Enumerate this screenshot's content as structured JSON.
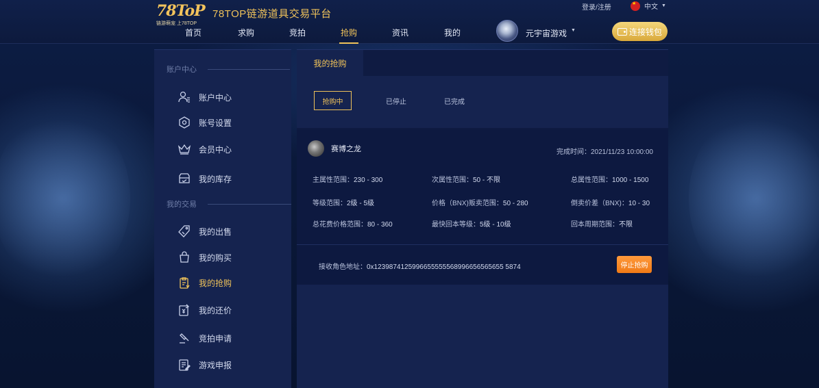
{
  "header": {
    "logo_main": "78ToP",
    "logo_sub": "链游萌宠 上78TOP",
    "site_title": "78TOP链游道具交易平台",
    "login_link": "登录/注册",
    "language": "中文",
    "nav": [
      "首页",
      "求购",
      "竞拍",
      "抢购",
      "资讯",
      "我的"
    ],
    "active_nav": "抢购",
    "game_name": "元宇宙游戏",
    "connect_wallet": "连接钱包"
  },
  "sidebar": {
    "section_account": "账户中心",
    "account_items": [
      {
        "label": "账户中心",
        "icon": "user-icon"
      },
      {
        "label": "账号设置",
        "icon": "settings-hexagon-icon"
      },
      {
        "label": "会员中心",
        "icon": "crown-icon"
      },
      {
        "label": "我的库存",
        "icon": "inventory-box-icon"
      }
    ],
    "section_trade": "我的交易",
    "trade_items": [
      {
        "label": "我的出售",
        "icon": "price-tag-icon"
      },
      {
        "label": "我的购买",
        "icon": "shopping-bag-icon"
      },
      {
        "label": "我的抢购",
        "icon": "clipboard-icon"
      },
      {
        "label": "我的还价",
        "icon": "bargain-icon"
      },
      {
        "label": "竞拍申请",
        "icon": "gavel-icon"
      },
      {
        "label": "游戏申报",
        "icon": "report-edit-icon"
      }
    ],
    "active_item": "我的抢购"
  },
  "main": {
    "tab_label": "我的抢购",
    "filters": [
      "抢购中",
      "已停止",
      "已完成"
    ],
    "active_filter": "抢购中",
    "card": {
      "user_name": "赛博之龙",
      "finish_time_label": "完成时间：",
      "finish_time": "2021/11/23 10:00:00",
      "attributes": [
        {
          "key": "主属性范围：",
          "value": "230 - 300"
        },
        {
          "key": "次属性范围：",
          "value": "50 - 不限"
        },
        {
          "key": "总属性范围：",
          "value": "1000 - 1500"
        },
        {
          "key": "等级范围：",
          "value": "2级 - 5级"
        },
        {
          "key": "价格（BNX)贩卖范围：",
          "value": "50 - 280"
        },
        {
          "key": "倒卖价差（BNX)：",
          "value": "10 - 30"
        },
        {
          "key": "总花费价格范围：",
          "value": "80 - 360"
        },
        {
          "key": "最快回本等级：",
          "value": "5级 - 10级"
        },
        {
          "key": "回本周期范围：",
          "value": "不限"
        }
      ],
      "address_label": "接收角色地址：",
      "address": "0x1239874125996655555568996656565655 5874",
      "stop_button": "停止抢购"
    }
  },
  "colors": {
    "accent_gold": "#f0c35a",
    "panel_bg": "#15234f",
    "card_bg": "#0d1940",
    "stop_orange": "#f07a16"
  }
}
